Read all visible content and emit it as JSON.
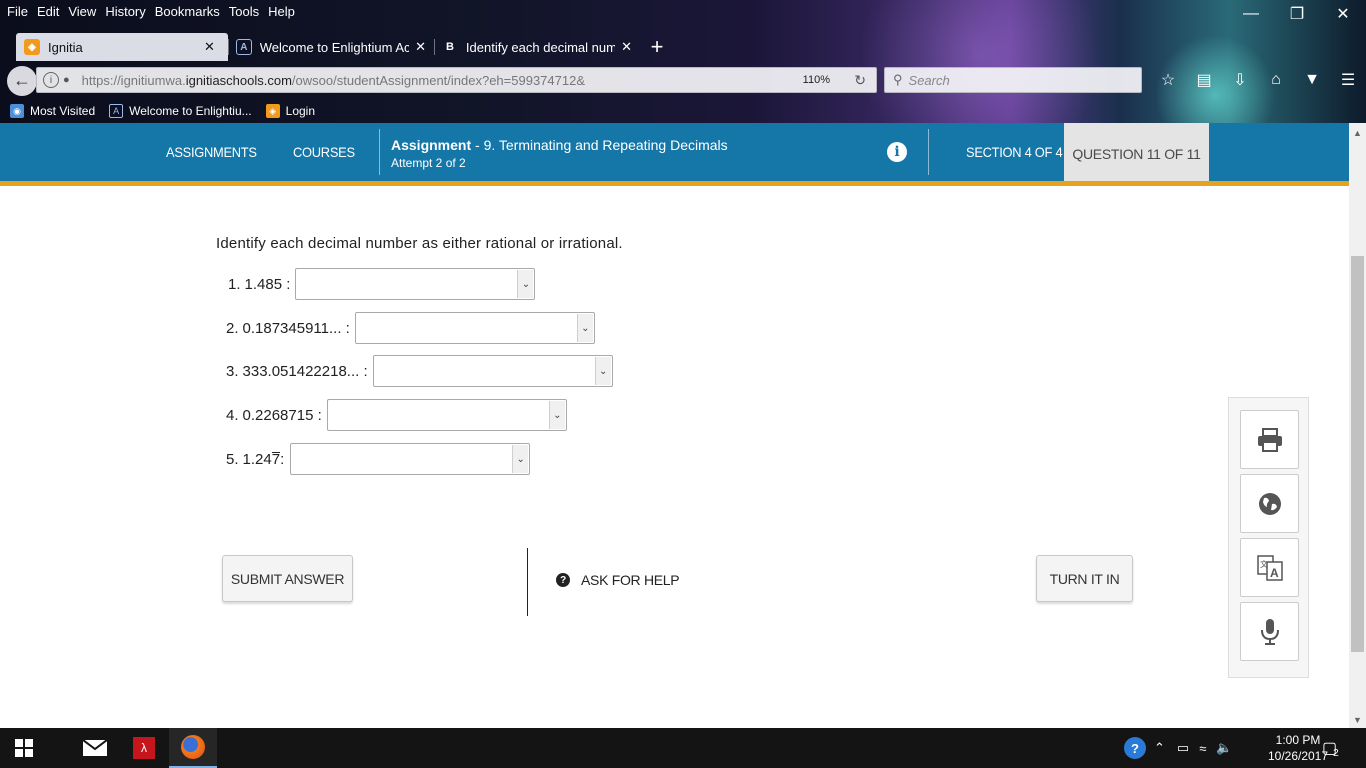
{
  "browser": {
    "menu": [
      "File",
      "Edit",
      "View",
      "History",
      "Bookmarks",
      "Tools",
      "Help"
    ],
    "tabs": [
      {
        "label": "Ignitia",
        "active": true
      },
      {
        "label": "Welcome to Enlightium Aca"
      },
      {
        "label": "Identify each decimal numb"
      }
    ],
    "url_prefix": "https://ignitiumwa.",
    "url_domain": "ignitiaschools.com",
    "url_path": "/owsoo/studentAssignment/index?eh=599374712&",
    "zoom": "110%",
    "search_placeholder": "Search",
    "bookmarks": [
      "Most Visited",
      "Welcome to Enlightiu...",
      "Login"
    ]
  },
  "header": {
    "nav": [
      "ASSIGNMENTS",
      "COURSES"
    ],
    "assignment_label": "Assignment",
    "assignment_title": " - 9. Terminating and Repeating Decimals",
    "attempt": "Attempt 2 of 2",
    "section": "SECTION 4 OF 4",
    "question": "QUESTION 11 OF 11"
  },
  "question": {
    "prompt": "Identify each decimal number as either rational or irrational.",
    "items": [
      {
        "num": "1.",
        "value": "1.485 :",
        "selected": ""
      },
      {
        "num": "2.",
        "value": "0.187345911... :",
        "selected": ""
      },
      {
        "num": "3.",
        "value": "333.051422218... :",
        "selected": ""
      },
      {
        "num": "4.",
        "value": "0.2268715 :",
        "selected": ""
      },
      {
        "num": "5.",
        "value_base": "1.24",
        "value_repeat": "7",
        "value_suffix": " :",
        "selected": ""
      }
    ]
  },
  "actions": {
    "submit": "SUBMIT ANSWER",
    "ask_help": "ASK FOR HELP",
    "turn_in": "TURN IT IN"
  },
  "tools": [
    "printer-icon",
    "globe-icon",
    "translate-icon",
    "microphone-icon"
  ],
  "taskbar": {
    "time": "1:00 PM",
    "date": "10/26/2017",
    "notifications": "2"
  },
  "colors": {
    "header_blue": "#1576a8",
    "accent_gold": "#e5a21c"
  }
}
